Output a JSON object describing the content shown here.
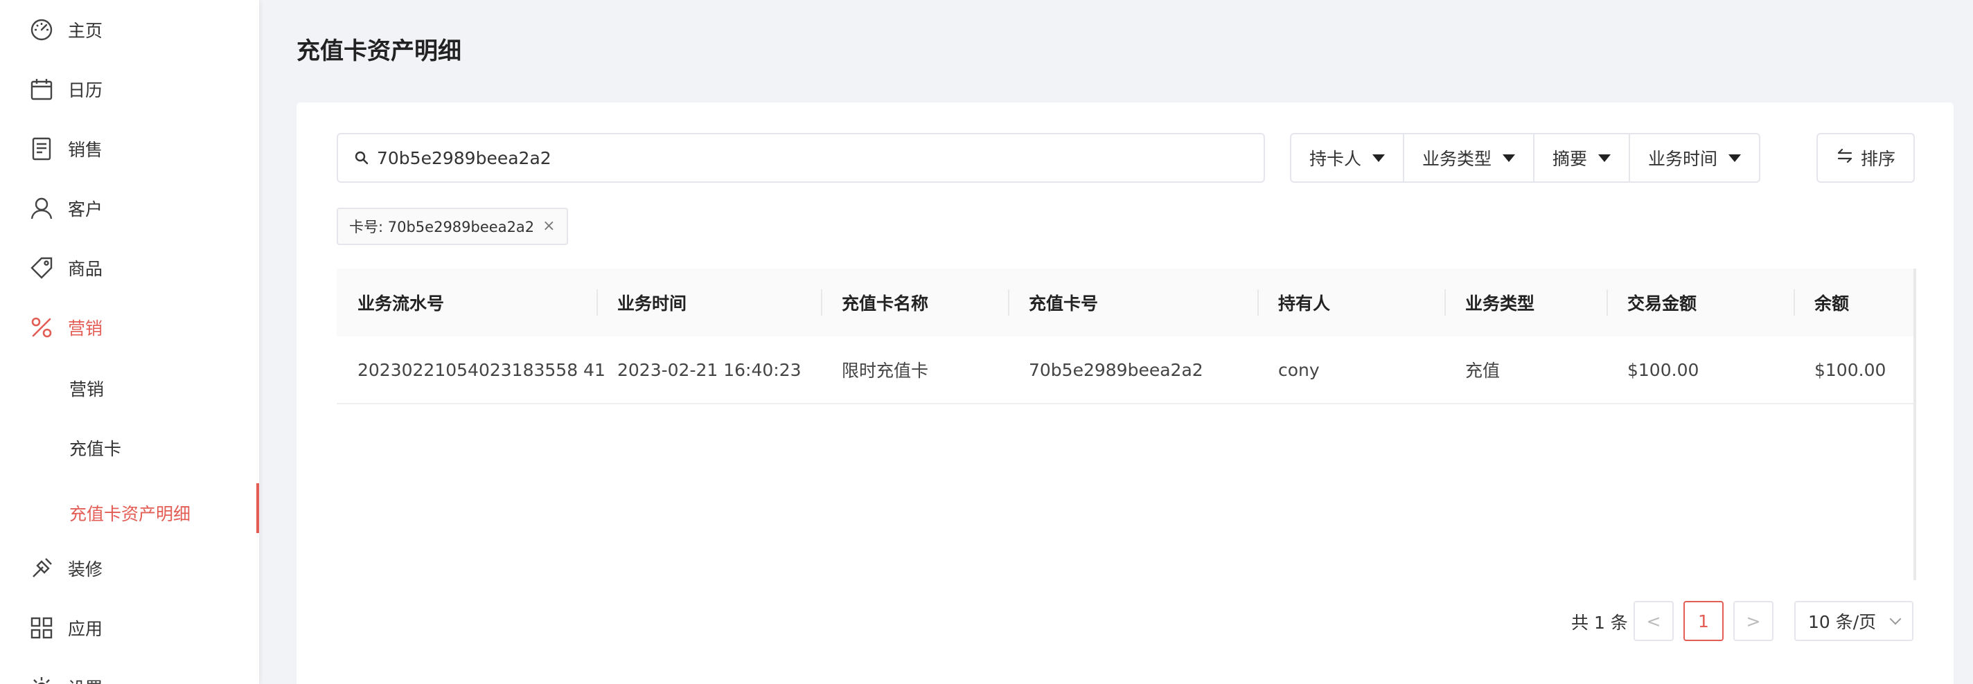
{
  "sidebar": {
    "items": [
      {
        "label": "主页",
        "icon": "dashboard-icon"
      },
      {
        "label": "日历",
        "icon": "calendar-icon"
      },
      {
        "label": "销售",
        "icon": "receipt-icon"
      },
      {
        "label": "客户",
        "icon": "user-icon"
      },
      {
        "label": "商品",
        "icon": "tag-icon"
      },
      {
        "label": "营销",
        "icon": "percent-icon"
      },
      {
        "label": "装修",
        "icon": "brush-icon"
      },
      {
        "label": "应用",
        "icon": "apps-icon"
      },
      {
        "label": "设置",
        "icon": "gear-icon"
      }
    ],
    "sub_items": [
      {
        "label": "营销"
      },
      {
        "label": "充值卡"
      },
      {
        "label": "充值卡资产明细"
      }
    ]
  },
  "page": {
    "title": "充值卡资产明细"
  },
  "search": {
    "value": "70b5e2989beea2a2"
  },
  "filters": [
    {
      "label": "持卡人"
    },
    {
      "label": "业务类型"
    },
    {
      "label": "摘要"
    },
    {
      "label": "业务时间"
    }
  ],
  "sort": {
    "label": "排序"
  },
  "active_tag": {
    "label": "卡号: 70b5e2989beea2a2",
    "close": "×"
  },
  "table": {
    "columns": [
      "业务流水号",
      "业务时间",
      "充值卡名称",
      "充值卡号",
      "持有人",
      "业务类型",
      "交易金额",
      "余额"
    ],
    "rows": [
      [
        "20230221054023183558 41",
        "2023-02-21 16:40:23",
        "限时充值卡",
        "70b5e2989beea2a2",
        "cony",
        "充值",
        "$100.00",
        "$100.00"
      ]
    ]
  },
  "pagination": {
    "total": "共 1 条",
    "prev": "<",
    "current": "1",
    "next": ">",
    "page_size": "10 条/页"
  },
  "colors": {
    "accent": "#e35d54",
    "background": "#f2f3f6",
    "border": "#e5e6eb"
  }
}
